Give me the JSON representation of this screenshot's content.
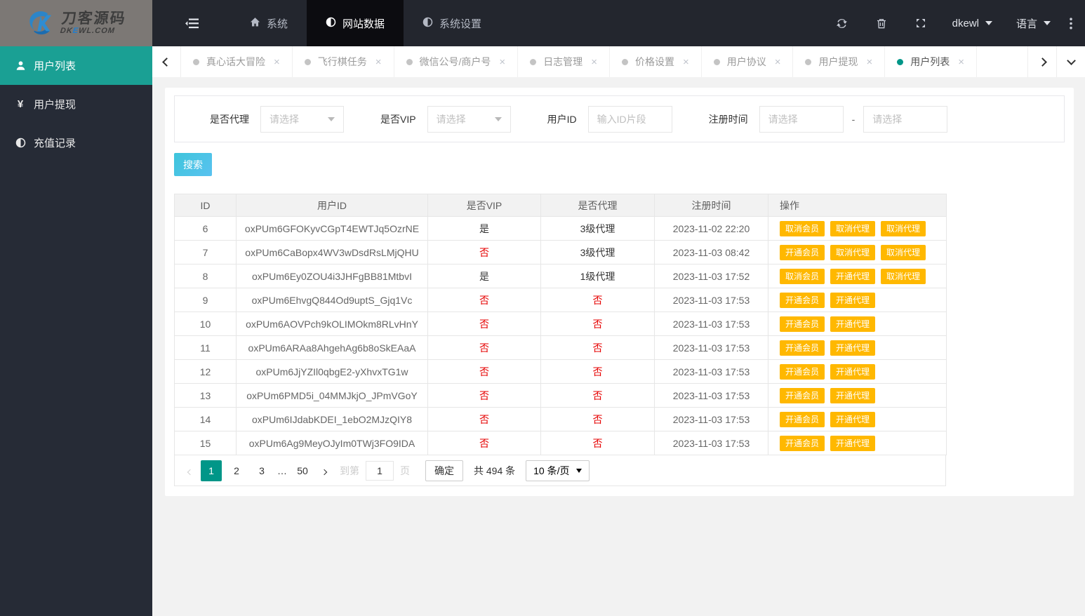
{
  "colors": {
    "accent_teal": "#1AA094",
    "pagination_active": "#009688",
    "action_orange": "#FFB800",
    "danger_red": "#E60000",
    "search_gradient_start": "#3EC5DB",
    "search_gradient_end": "#59C2F0"
  },
  "brand": {
    "title": "刀客源码",
    "subtitle": "DKEWL.COM"
  },
  "topnav": {
    "items": [
      {
        "label": "系统",
        "icon": "home",
        "active": false
      },
      {
        "label": "网站数据",
        "icon": "pie",
        "active": true
      },
      {
        "label": "系统设置",
        "icon": "pie",
        "active": false
      }
    ],
    "username": "dkewl",
    "language_label": "语言"
  },
  "sidebar": {
    "items": [
      {
        "label": "用户列表",
        "icon": "user",
        "active": true
      },
      {
        "label": "用户提现",
        "icon": "yen",
        "active": false
      },
      {
        "label": "充值记录",
        "icon": "pie",
        "active": false
      }
    ]
  },
  "tabs": [
    {
      "label": "真心话大冒险",
      "active": false
    },
    {
      "label": "飞行棋任务",
      "active": false
    },
    {
      "label": "微信公号/商户号",
      "active": false
    },
    {
      "label": "日志管理",
      "active": false
    },
    {
      "label": "价格设置",
      "active": false
    },
    {
      "label": "用户协议",
      "active": false
    },
    {
      "label": "用户提现",
      "active": false
    },
    {
      "label": "用户列表",
      "active": true
    }
  ],
  "filters": {
    "agent_label": "是否代理",
    "agent_placeholder": "请选择",
    "vip_label": "是否VIP",
    "vip_placeholder": "请选择",
    "userid_label": "用户ID",
    "userid_placeholder": "输入ID片段",
    "time_label": "注册时间",
    "time_start_placeholder": "请选择",
    "time_end_placeholder": "请选择",
    "range_separator": "-"
  },
  "search_button": "搜索",
  "table": {
    "headers": [
      "ID",
      "用户ID",
      "是否VIP",
      "是否代理",
      "注册时间",
      "操作"
    ],
    "rows": [
      {
        "id": "6",
        "user_id": "oxPUm6GFOKyvCGpT4EWTJq5OzrNE",
        "vip": "是",
        "agent": "3级代理",
        "time": "2023-11-02 22:20",
        "actions": [
          "取消会员",
          "取消代理",
          "取消代理"
        ]
      },
      {
        "id": "7",
        "user_id": "oxPUm6CaBopx4WV3wDsdRsLMjQHU",
        "vip": "否",
        "agent": "3级代理",
        "time": "2023-11-03 08:42",
        "actions": [
          "开通会员",
          "取消代理",
          "取消代理"
        ]
      },
      {
        "id": "8",
        "user_id": "oxPUm6Ey0ZOU4i3JHFgBB81MtbvI",
        "vip": "是",
        "agent": "1级代理",
        "time": "2023-11-03 17:52",
        "actions": [
          "取消会员",
          "开通代理",
          "取消代理"
        ]
      },
      {
        "id": "9",
        "user_id": "oxPUm6EhvgQ844Od9uptS_Gjq1Vc",
        "vip": "否",
        "agent": "否",
        "time": "2023-11-03 17:53",
        "actions": [
          "开通会员",
          "开通代理"
        ]
      },
      {
        "id": "10",
        "user_id": "oxPUm6AOVPch9kOLIMOkm8RLvHnY",
        "vip": "否",
        "agent": "否",
        "time": "2023-11-03 17:53",
        "actions": [
          "开通会员",
          "开通代理"
        ]
      },
      {
        "id": "11",
        "user_id": "oxPUm6ARAa8AhgehAg6b8oSkEAaA",
        "vip": "否",
        "agent": "否",
        "time": "2023-11-03 17:53",
        "actions": [
          "开通会员",
          "开通代理"
        ]
      },
      {
        "id": "12",
        "user_id": "oxPUm6JjYZIl0qbgE2-yXhvxTG1w",
        "vip": "否",
        "agent": "否",
        "time": "2023-11-03 17:53",
        "actions": [
          "开通会员",
          "开通代理"
        ]
      },
      {
        "id": "13",
        "user_id": "oxPUm6PMD5i_04MMJkjO_JPmVGoY",
        "vip": "否",
        "agent": "否",
        "time": "2023-11-03 17:53",
        "actions": [
          "开通会员",
          "开通代理"
        ]
      },
      {
        "id": "14",
        "user_id": "oxPUm6IJdabKDEI_1ebO2MJzQIY8",
        "vip": "否",
        "agent": "否",
        "time": "2023-11-03 17:53",
        "actions": [
          "开通会员",
          "开通代理"
        ]
      },
      {
        "id": "15",
        "user_id": "oxPUm6Ag9MeyOJyIm0TWj3FO9IDA",
        "vip": "否",
        "agent": "否",
        "time": "2023-11-03 17:53",
        "actions": [
          "开通会员",
          "开通代理"
        ]
      }
    ]
  },
  "pagination": {
    "pages": [
      {
        "label": "1",
        "active": true
      },
      {
        "label": "2",
        "active": false
      },
      {
        "label": "3",
        "active": false
      },
      {
        "label": "…",
        "ellipsis": true
      },
      {
        "label": "50",
        "active": false
      }
    ],
    "jump_prefix": "到第",
    "jump_value": "1",
    "jump_suffix": "页",
    "confirm_label": "确定",
    "total_text": "共 494 条",
    "page_size_text": "10 条/页"
  }
}
